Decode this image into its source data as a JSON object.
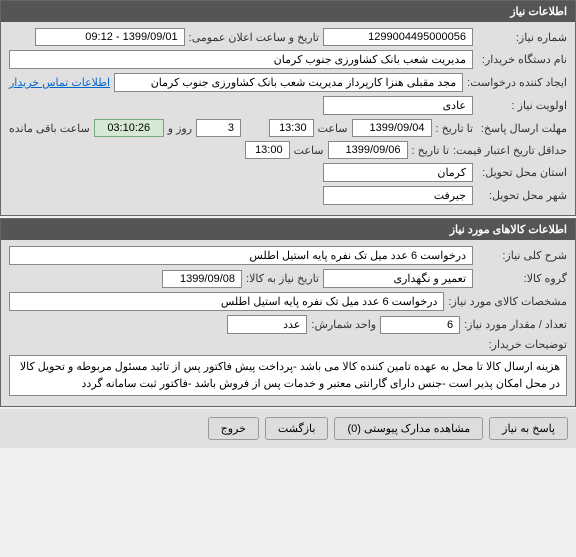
{
  "panel1": {
    "title": "اطلاعات نیاز",
    "request_no_label": "شماره نیاز:",
    "request_no": "1299004495000056",
    "public_datetime_label": "تاریخ و ساعت اعلان عمومی:",
    "public_datetime": "1399/09/01 - 09:12",
    "buyer_label": "نام دستگاه خریدار:",
    "buyer": "مدیریت شعب بانک کشاورزی جنوب کرمان",
    "creator_label": "ایجاد کننده درخواست:",
    "creator": "مجد مقبلی هنزا کارپرداز مدیریت شعب بانک کشاورزی جنوب کرمان",
    "contact_link": "اطلاعات تماس خریدار",
    "priority_label": "اولویت نیاز :",
    "priority": "عادی",
    "deadline_label": "مهلت ارسال پاسخ:",
    "until_label": "تا تاریخ :",
    "deadline_date": "1399/09/04",
    "time_label": "ساعت",
    "deadline_time": "13:30",
    "days_value": "3",
    "days_label": "روز و",
    "timer": "03:10:26",
    "remaining_label": "ساعت باقی مانده",
    "validity_label": "حداقل تاریخ اعتبار قیمت:",
    "validity_until_label": "تا تاریخ :",
    "validity_date": "1399/09/06",
    "validity_time": "13:00",
    "province_label": "استان محل تحویل:",
    "province": "کرمان",
    "city_label": "شهر محل تحویل:",
    "city": "جیرفت"
  },
  "panel2": {
    "title": "اطلاعات کالاهای مورد نیاز",
    "desc_label": "شرح کلی نیاز:",
    "desc": "درخواست 6 عدد میل تک نفره پایه استیل اطلس",
    "group_label": "گروه کالا:",
    "group": "تعمیر و نگهداری",
    "base_date_label": "تاریخ نیاز به کالا:",
    "base_date": "1399/09/08",
    "spec_label": "مشخصات کالای مورد نیاز:",
    "spec": "درخواست 6 عدد میل تک نفره پایه استیل اطلس",
    "qty_label": "تعداد / مقدار مورد نیاز:",
    "qty": "6",
    "unit_label": "واحد شمارش:",
    "unit": "عدد",
    "notes_label": "توضیحات خریدار:",
    "notes": "هزینه ارسال کالا تا محل به عهده تامین کننده کالا می باشد -پرداخت پیش فاکتور پس از تائید مسئول مربوطه و تحویل کالا در محل امکان پذیر است -جنس دارای گارانتی معتبر و خدمات پس از فروش باشد -فاکتور ثبت سامانه گردد"
  },
  "buttons": {
    "reply": "پاسخ به نیاز",
    "attachments": "مشاهده مدارک پیوستی (0)",
    "back": "بازگشت",
    "exit": "خروج"
  }
}
